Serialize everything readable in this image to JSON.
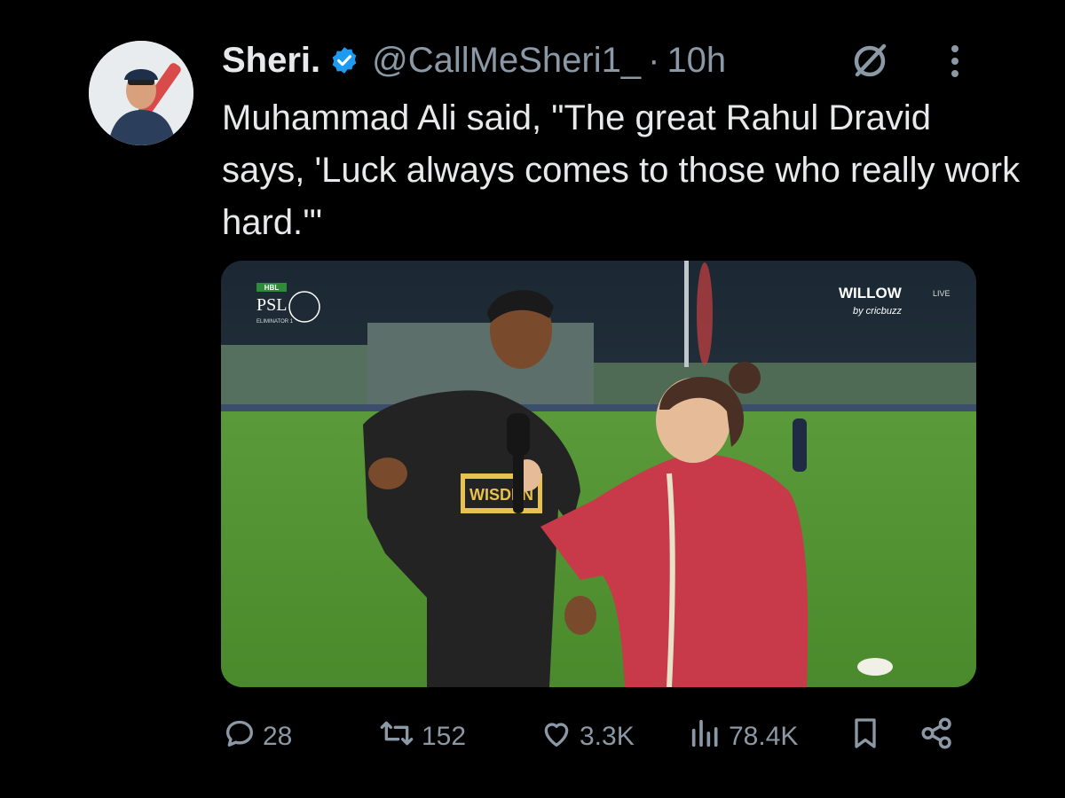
{
  "tweet": {
    "author_name": "Sheri.",
    "handle": "@CallMeSheri1_",
    "separator": "·",
    "time": "10h",
    "text": "Muhammad Ali said, \"The great Rahul Dravid says, 'Luck always comes to those who really work hard.'\"",
    "verified_color": "#1d9bf0"
  },
  "media": {
    "overlay_left_brand": "HBL",
    "overlay_left_logo": "PSL",
    "overlay_left_sub": "ELIMINATOR 1",
    "overlay_right_brand": "WILLOW",
    "overlay_right_live": "LIVE",
    "overlay_right_by": "by cricbuzz",
    "shirt_sponsor": "WISDEN"
  },
  "actions": {
    "replies": "28",
    "reposts": "152",
    "likes": "3.3K",
    "views": "78.4K"
  },
  "icons": [
    "verified-badge-icon",
    "grok-icon",
    "more-icon",
    "reply-icon",
    "repost-icon",
    "like-icon",
    "views-icon",
    "bookmark-icon",
    "share-icon"
  ]
}
